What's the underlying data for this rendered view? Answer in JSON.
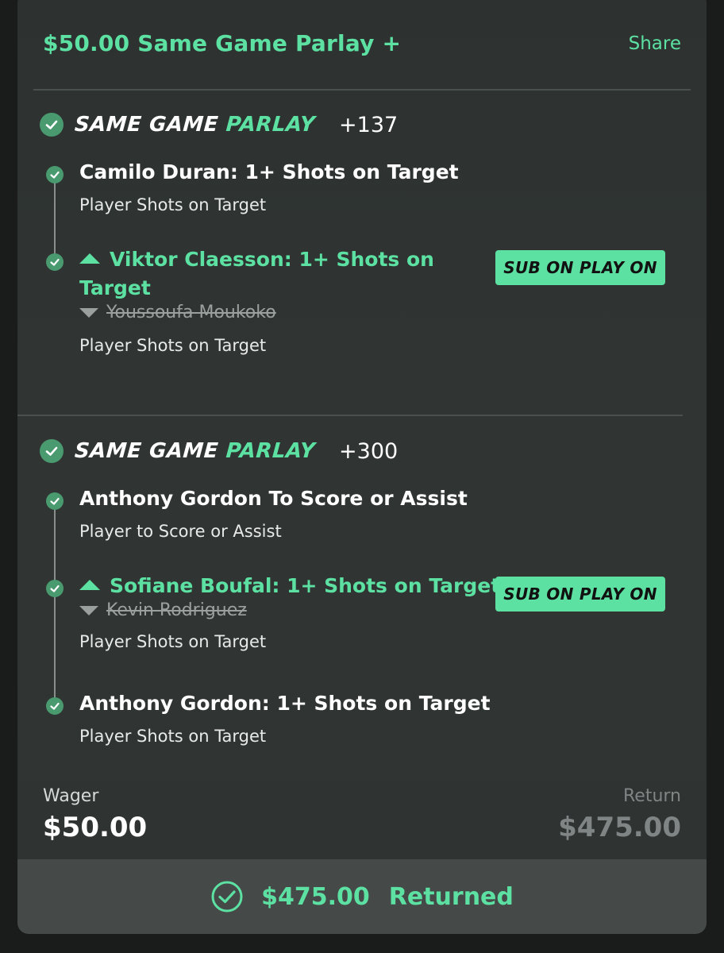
{
  "header": {
    "title": "$50.00 Same Game Parlay +",
    "share_label": "Share"
  },
  "parlays": [
    {
      "label_main": "SAME GAME ",
      "label_accent": "PARLAY",
      "odds": "+137",
      "legs": [
        {
          "title": "Camilo Duran: 1+ Shots on Target",
          "subtitle": "Player Shots on Target"
        },
        {
          "title_line1": "Viktor Claesson: 1+ Shots on",
          "title_line2": "Target",
          "original": "Youssoufa Moukoko",
          "subtitle": "Player Shots on Target",
          "badge": "SUB ON PLAY ON"
        }
      ]
    },
    {
      "label_main": "SAME GAME ",
      "label_accent": "PARLAY",
      "odds": "+300",
      "legs": [
        {
          "title": "Anthony Gordon To Score or Assist",
          "subtitle": "Player to Score or Assist"
        },
        {
          "title": "Sofiane Boufal: 1+ Shots on Target",
          "original": "Kevin Rodriguez",
          "subtitle": "Player Shots on Target",
          "badge": "SUB ON PLAY ON"
        },
        {
          "title": "Anthony Gordon: 1+ Shots on Target",
          "subtitle": "Player Shots on Target"
        }
      ]
    }
  ],
  "footer": {
    "wager_label": "Wager",
    "wager_value": "$50.00",
    "return_label": "Return",
    "return_value": "$475.00",
    "returned_amount": "$475.00",
    "returned_label": "Returned"
  },
  "colors": {
    "accent": "#5ce1a3",
    "check": "#4a9a70",
    "card": "#2f3433",
    "bar": "#454a49"
  }
}
